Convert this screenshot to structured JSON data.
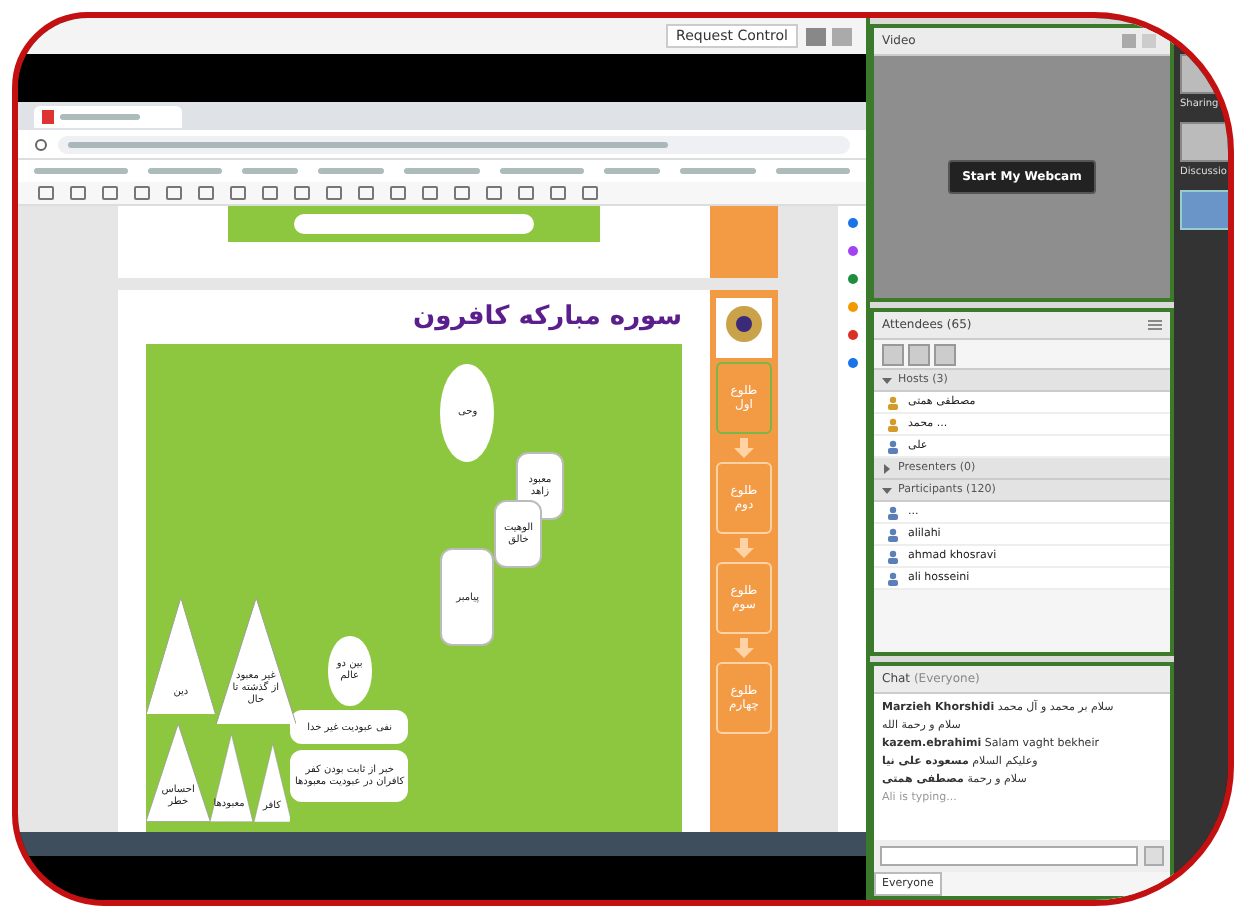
{
  "meeting_bar": {
    "request_control": "Request Control"
  },
  "slide": {
    "title": "سوره مبارکه کافرون",
    "nodes": [
      {
        "kind": "oval",
        "label": "وحی"
      },
      {
        "kind": "card",
        "label": "معبود زاهد"
      },
      {
        "kind": "card",
        "label": "الوهیت خالق"
      },
      {
        "kind": "card",
        "label": "پیامبر"
      },
      {
        "kind": "circle",
        "label": "بین دو عالم"
      },
      {
        "kind": "pill",
        "label": "نفی عبودیت غیر خدا"
      },
      {
        "kind": "pill",
        "label": "خبر از ثابت بودن کفر کافران در عبودیت معبودها"
      },
      {
        "kind": "triangle",
        "label": "دین"
      },
      {
        "kind": "triangle",
        "label": "غیر معبود از گذشته تا حال"
      },
      {
        "kind": "triangle",
        "label": "کافر"
      },
      {
        "kind": "triangle",
        "label": "معبودها"
      },
      {
        "kind": "triangle",
        "label": "احساس خطر"
      }
    ],
    "steps": [
      {
        "label": "طلوع اول",
        "selected": true
      },
      {
        "label": "طلوع دوم",
        "selected": false
      },
      {
        "label": "طلوع سوم",
        "selected": false
      },
      {
        "label": "طلوع چهارم",
        "selected": false
      }
    ]
  },
  "video": {
    "title": "Video",
    "button": "Start My Webcam"
  },
  "layouts": [
    {
      "label": "Sharing",
      "selected": false
    },
    {
      "label": "Discussio",
      "selected": false
    },
    {
      "selected": true
    }
  ],
  "attendees": {
    "title": "Attendees (65)",
    "groups": [
      {
        "name": "Hosts (3)",
        "expanded": true,
        "people": [
          {
            "name": "مصطفی همتی",
            "kind": "host"
          },
          {
            "name": "محمد ...",
            "kind": "host"
          },
          {
            "name": "علی",
            "kind": "participant"
          }
        ]
      },
      {
        "name": "Presenters (0)",
        "expanded": false
      },
      {
        "name": "Participants (120)",
        "expanded": true,
        "people": [
          {
            "name": "...",
            "kind": "participant"
          },
          {
            "name": "alilahi",
            "kind": "participant"
          },
          {
            "name": "ahmad khosravi",
            "kind": "participant"
          },
          {
            "name": "ali hosseini",
            "kind": "participant"
          }
        ]
      }
    ]
  },
  "chat": {
    "title": "Chat",
    "scope": "(Everyone)",
    "messages": [
      {
        "author": "Marzieh Khorshidi",
        "text": "سلام بر محمد و آل محمد"
      },
      {
        "text": "سلام و رحمة الله"
      },
      {
        "author": "kazem.ebrahimi",
        "text": "Salam vaght bekheir"
      },
      {
        "author": "مسعوده علی نیا",
        "text": "وعلیکم السلام"
      },
      {
        "author": "مصطفی همتی",
        "text": "سلام و رحمة"
      }
    ],
    "typing": "Ali is typing...",
    "tab": "Everyone"
  }
}
